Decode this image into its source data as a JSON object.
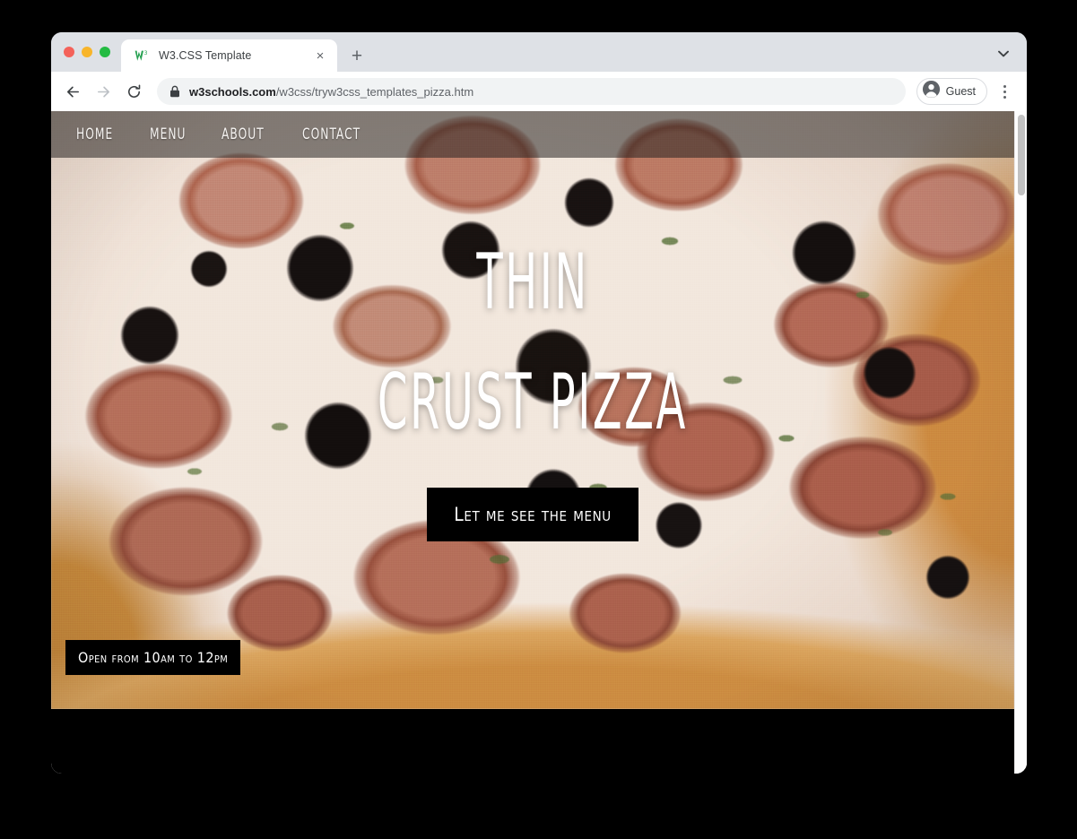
{
  "browser": {
    "window_controls": [
      {
        "name": "close",
        "color": "#f4625a"
      },
      {
        "name": "minimize",
        "color": "#f8b52b"
      },
      {
        "name": "maximize",
        "color": "#24bb43"
      }
    ],
    "tab": {
      "title": "W3.CSS Template",
      "favicon": "w3schools-logo-icon",
      "close_label": "×"
    },
    "new_tab_label": "+",
    "tab_list_icon": "chevron-down-icon",
    "toolbar": {
      "back_icon": "arrow-left-icon",
      "forward_icon": "arrow-right-icon",
      "reload_icon": "reload-icon",
      "lock_icon": "lock-icon",
      "url_domain": "w3schools.com",
      "url_path": "/w3css/tryw3css_templates_pizza.htm",
      "url_full": "w3schools.com/w3css/tryw3css_templates_pizza.htm",
      "profile_label": "Guest",
      "profile_icon": "account-circle-icon",
      "menu_icon": "kebab-menu-icon"
    }
  },
  "site": {
    "nav": [
      {
        "label": "Home"
      },
      {
        "label": "Menu"
      },
      {
        "label": "About"
      },
      {
        "label": "Contact"
      }
    ],
    "hero": {
      "title_line_1": "Thin",
      "title_line_2": "Crust Pizza",
      "cta_label": "Let me see the menu",
      "background_image": "pizza-pepperoni-olives-photo"
    },
    "hours_banner": "Open from 10am to 12pm"
  },
  "colors": {
    "page_black": "#000000",
    "button_black": "#000000",
    "nav_overlay": "rgba(40,36,34,0.55)",
    "hero_text": "#ffffff",
    "browser_chrome": "#dee1e6",
    "omnibox_bg": "#f1f3f4",
    "favicon_green": "#25a050"
  }
}
